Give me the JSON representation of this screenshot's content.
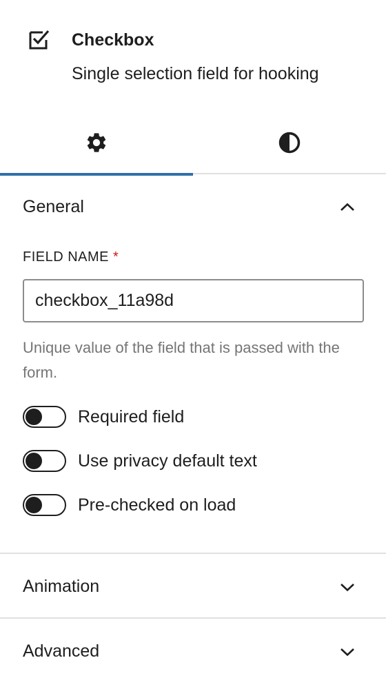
{
  "block": {
    "icon": "checkbox-icon",
    "title": "Checkbox",
    "description": "Single selection field for hooking"
  },
  "tabs": [
    {
      "icon": "gear-icon",
      "active": true
    },
    {
      "icon": "contrast-icon",
      "active": false
    }
  ],
  "panels": {
    "general": {
      "title": "General",
      "expanded": true,
      "chevron": "chevron-up-icon",
      "field_name_label": "FIELD NAME",
      "required_marker": "*",
      "field_name_value": "checkbox_11a98d",
      "help_text": "Unique value of the field that is passed with the form.",
      "toggles": [
        {
          "label": "Required field",
          "checked": false
        },
        {
          "label": "Use privacy default text",
          "checked": false
        },
        {
          "label": "Pre-checked on load",
          "checked": false
        }
      ]
    },
    "animation": {
      "title": "Animation",
      "expanded": false,
      "chevron": "chevron-down-icon"
    },
    "advanced": {
      "title": "Advanced",
      "expanded": false,
      "chevron": "chevron-down-icon"
    }
  },
  "colors": {
    "accent": "#2f6fa8",
    "required": "#cc1818",
    "help_text": "#757575",
    "divider": "#e0e0e0",
    "text": "#1e1e1e"
  }
}
